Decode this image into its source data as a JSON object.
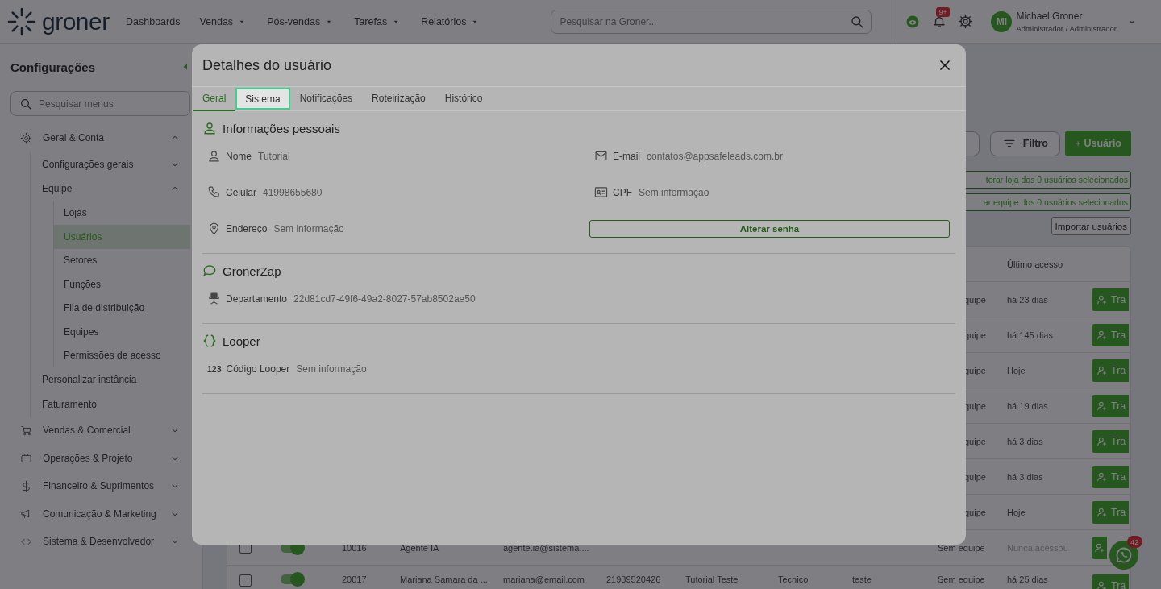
{
  "header": {
    "logo_text": "groner",
    "nav": [
      {
        "label": "Dashboards",
        "dropdown": false
      },
      {
        "label": "Vendas",
        "dropdown": true
      },
      {
        "label": "Pós-vendas",
        "dropdown": true
      },
      {
        "label": "Tarefas",
        "dropdown": true
      },
      {
        "label": "Relatórios",
        "dropdown": true
      }
    ],
    "search": {
      "placeholder": "Pesquisar na Groner..."
    },
    "notifications_badge": "9+",
    "user": {
      "initials": "MI",
      "name": "Michael Groner",
      "role": "Administrador / Administrador"
    }
  },
  "sidebar": {
    "title": "Configurações",
    "search": {
      "placeholder": "Pesquisar menus"
    },
    "items": [
      {
        "label": "Geral & Conta",
        "expanded": true,
        "selected": false,
        "children": [
          {
            "label": "Configurações gerais",
            "expanded": false,
            "selected": false
          },
          {
            "label": "Equipe",
            "expanded": true,
            "selected": false,
            "children": [
              {
                "label": "Lojas",
                "selected": false
              },
              {
                "label": "Usuários",
                "selected": true
              },
              {
                "label": "Setores",
                "selected": false
              },
              {
                "label": "Funções",
                "selected": false
              },
              {
                "label": "Fila de distribuição",
                "selected": false
              },
              {
                "label": "Equipes",
                "selected": false
              },
              {
                "label": "Permissões de acesso",
                "selected": false
              }
            ]
          },
          {
            "label": "Personalizar instância",
            "selected": false
          },
          {
            "label": "Faturamento",
            "selected": false
          }
        ]
      },
      {
        "label": "Vendas & Comercial",
        "expanded": false,
        "selected": false
      },
      {
        "label": "Operações & Projeto",
        "expanded": false,
        "selected": false
      },
      {
        "label": "Financeiro & Suprimentos",
        "expanded": false,
        "selected": false
      },
      {
        "label": "Comunicação & Marketing",
        "expanded": false,
        "selected": false
      },
      {
        "label": "Sistema & Desenvolvedor",
        "expanded": false,
        "selected": false
      }
    ]
  },
  "page": {
    "toolbar": {
      "filter_button": "Filtro",
      "add_button": "Usuário"
    },
    "bulk_actions": [
      "terar loja dos 0 usuários selecionados",
      "ar equipe dos 0 usuários selecionados"
    ],
    "import_button": "Importar usuários",
    "table": {
      "columns": {
        "last_access": "Último acesso"
      },
      "rows": [
        {
          "team": "quipe",
          "last_access": "há 23 dias",
          "last_access_muted": false,
          "action": "Tra"
        },
        {
          "team": "quipe",
          "last_access": "há 145 dias",
          "last_access_muted": false,
          "action": "Tra"
        },
        {
          "team": "quipe",
          "last_access": "Hoje",
          "last_access_muted": false,
          "action": "Tra"
        },
        {
          "team": "quipe",
          "last_access": "há 19 dias",
          "last_access_muted": false,
          "action": "Tra"
        },
        {
          "team": "quipe",
          "last_access": "há 3 dias",
          "last_access_muted": false,
          "action": "Tra"
        },
        {
          "team": "quipe",
          "last_access": "há 3 dias",
          "last_access_muted": false,
          "action": "Tra"
        },
        {
          "team": "quipe",
          "last_access": "Hoje",
          "last_access_muted": false,
          "action": "Tra"
        },
        {
          "checked": false,
          "on": true,
          "id": "10016",
          "name": "Agente IA",
          "email": "agente.ia@sistema....",
          "team": "Sem equipe",
          "last_access": "Nunca acessou",
          "last_access_muted": true
        },
        {
          "checked": false,
          "on": true,
          "id": "20017",
          "name": "Mariana Samara da ...",
          "email": "mariana@email.com",
          "phone": "21989520426",
          "column_7": "Tutorial Teste",
          "column_8": "Tecnico",
          "column_9": "teste",
          "team": "Sem equipe",
          "last_access": "há 25 dias",
          "last_access_muted": false,
          "action": "Tra"
        }
      ]
    }
  },
  "chat_fab": {
    "badge": "42"
  },
  "modal": {
    "title": "Detalhes do usuário",
    "tabs": [
      {
        "label": "Geral",
        "selected": true,
        "focused": false
      },
      {
        "label": "Sistema",
        "selected": false,
        "focused": true
      },
      {
        "label": "Notificações",
        "selected": false,
        "focused": false
      },
      {
        "label": "Roteirização",
        "selected": false,
        "focused": false
      },
      {
        "label": "Histórico",
        "selected": false,
        "focused": false
      }
    ],
    "sections": [
      {
        "title": "Informações pessoais",
        "fields": [
          {
            "kind": "field",
            "label": "Nome",
            "value": "Tutorial"
          },
          {
            "kind": "field",
            "label": "E-mail",
            "value": "contatos@appsafeleads.com.br"
          },
          {
            "kind": "field",
            "label": "Celular",
            "value": "41998655680"
          },
          {
            "kind": "field",
            "label": "CPF",
            "value": "Sem informação"
          },
          {
            "kind": "field",
            "label": "Endereço",
            "value": "Sem informação"
          },
          {
            "kind": "button",
            "label": "Alterar senha"
          }
        ]
      },
      {
        "title": "GronerZap",
        "fields": [
          {
            "kind": "field",
            "label": "Departamento",
            "value": "22d81cd7-49f6-49a2-8027-57ab8502ae50"
          }
        ]
      },
      {
        "title": "Looper",
        "fields": [
          {
            "kind": "field",
            "label": "Código Looper",
            "value": "Sem informação",
            "icon_text": "123"
          }
        ]
      }
    ]
  }
}
